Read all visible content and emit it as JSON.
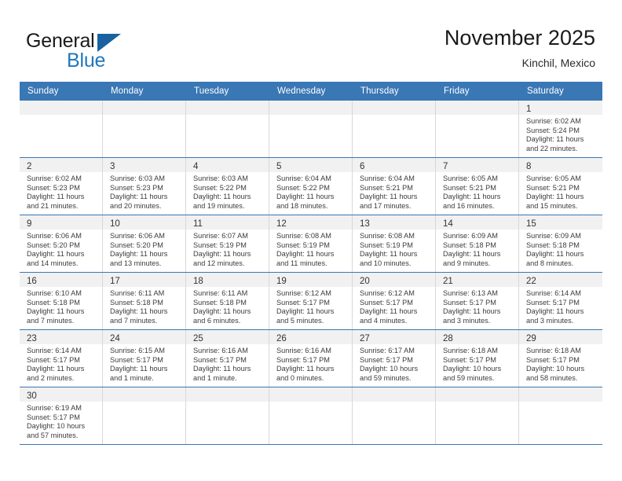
{
  "brand": {
    "name_top": "General",
    "name_bottom": "Blue",
    "accent_color": "#1f77bd",
    "triangle_color": "#18639f"
  },
  "header": {
    "month_title": "November 2025",
    "location": "Kinchil, Mexico",
    "header_band_color": "#3a77b5"
  },
  "weekdays": [
    "Sunday",
    "Monday",
    "Tuesday",
    "Wednesday",
    "Thursday",
    "Friday",
    "Saturday"
  ],
  "weeks": [
    [
      {
        "day": "",
        "sunrise": "",
        "sunset": "",
        "daylight_line1": "",
        "daylight_line2": "",
        "empty": true
      },
      {
        "day": "",
        "sunrise": "",
        "sunset": "",
        "daylight_line1": "",
        "daylight_line2": "",
        "empty": true
      },
      {
        "day": "",
        "sunrise": "",
        "sunset": "",
        "daylight_line1": "",
        "daylight_line2": "",
        "empty": true
      },
      {
        "day": "",
        "sunrise": "",
        "sunset": "",
        "daylight_line1": "",
        "daylight_line2": "",
        "empty": true
      },
      {
        "day": "",
        "sunrise": "",
        "sunset": "",
        "daylight_line1": "",
        "daylight_line2": "",
        "empty": true
      },
      {
        "day": "",
        "sunrise": "",
        "sunset": "",
        "daylight_line1": "",
        "daylight_line2": "",
        "empty": true
      },
      {
        "day": "1",
        "sunrise": "Sunrise: 6:02 AM",
        "sunset": "Sunset: 5:24 PM",
        "daylight_line1": "Daylight: 11 hours",
        "daylight_line2": "and 22 minutes.",
        "empty": false
      }
    ],
    [
      {
        "day": "2",
        "sunrise": "Sunrise: 6:02 AM",
        "sunset": "Sunset: 5:23 PM",
        "daylight_line1": "Daylight: 11 hours",
        "daylight_line2": "and 21 minutes.",
        "empty": false
      },
      {
        "day": "3",
        "sunrise": "Sunrise: 6:03 AM",
        "sunset": "Sunset: 5:23 PM",
        "daylight_line1": "Daylight: 11 hours",
        "daylight_line2": "and 20 minutes.",
        "empty": false
      },
      {
        "day": "4",
        "sunrise": "Sunrise: 6:03 AM",
        "sunset": "Sunset: 5:22 PM",
        "daylight_line1": "Daylight: 11 hours",
        "daylight_line2": "and 19 minutes.",
        "empty": false
      },
      {
        "day": "5",
        "sunrise": "Sunrise: 6:04 AM",
        "sunset": "Sunset: 5:22 PM",
        "daylight_line1": "Daylight: 11 hours",
        "daylight_line2": "and 18 minutes.",
        "empty": false
      },
      {
        "day": "6",
        "sunrise": "Sunrise: 6:04 AM",
        "sunset": "Sunset: 5:21 PM",
        "daylight_line1": "Daylight: 11 hours",
        "daylight_line2": "and 17 minutes.",
        "empty": false
      },
      {
        "day": "7",
        "sunrise": "Sunrise: 6:05 AM",
        "sunset": "Sunset: 5:21 PM",
        "daylight_line1": "Daylight: 11 hours",
        "daylight_line2": "and 16 minutes.",
        "empty": false
      },
      {
        "day": "8",
        "sunrise": "Sunrise: 6:05 AM",
        "sunset": "Sunset: 5:21 PM",
        "daylight_line1": "Daylight: 11 hours",
        "daylight_line2": "and 15 minutes.",
        "empty": false
      }
    ],
    [
      {
        "day": "9",
        "sunrise": "Sunrise: 6:06 AM",
        "sunset": "Sunset: 5:20 PM",
        "daylight_line1": "Daylight: 11 hours",
        "daylight_line2": "and 14 minutes.",
        "empty": false
      },
      {
        "day": "10",
        "sunrise": "Sunrise: 6:06 AM",
        "sunset": "Sunset: 5:20 PM",
        "daylight_line1": "Daylight: 11 hours",
        "daylight_line2": "and 13 minutes.",
        "empty": false
      },
      {
        "day": "11",
        "sunrise": "Sunrise: 6:07 AM",
        "sunset": "Sunset: 5:19 PM",
        "daylight_line1": "Daylight: 11 hours",
        "daylight_line2": "and 12 minutes.",
        "empty": false
      },
      {
        "day": "12",
        "sunrise": "Sunrise: 6:08 AM",
        "sunset": "Sunset: 5:19 PM",
        "daylight_line1": "Daylight: 11 hours",
        "daylight_line2": "and 11 minutes.",
        "empty": false
      },
      {
        "day": "13",
        "sunrise": "Sunrise: 6:08 AM",
        "sunset": "Sunset: 5:19 PM",
        "daylight_line1": "Daylight: 11 hours",
        "daylight_line2": "and 10 minutes.",
        "empty": false
      },
      {
        "day": "14",
        "sunrise": "Sunrise: 6:09 AM",
        "sunset": "Sunset: 5:18 PM",
        "daylight_line1": "Daylight: 11 hours",
        "daylight_line2": "and 9 minutes.",
        "empty": false
      },
      {
        "day": "15",
        "sunrise": "Sunrise: 6:09 AM",
        "sunset": "Sunset: 5:18 PM",
        "daylight_line1": "Daylight: 11 hours",
        "daylight_line2": "and 8 minutes.",
        "empty": false
      }
    ],
    [
      {
        "day": "16",
        "sunrise": "Sunrise: 6:10 AM",
        "sunset": "Sunset: 5:18 PM",
        "daylight_line1": "Daylight: 11 hours",
        "daylight_line2": "and 7 minutes.",
        "empty": false
      },
      {
        "day": "17",
        "sunrise": "Sunrise: 6:11 AM",
        "sunset": "Sunset: 5:18 PM",
        "daylight_line1": "Daylight: 11 hours",
        "daylight_line2": "and 7 minutes.",
        "empty": false
      },
      {
        "day": "18",
        "sunrise": "Sunrise: 6:11 AM",
        "sunset": "Sunset: 5:18 PM",
        "daylight_line1": "Daylight: 11 hours",
        "daylight_line2": "and 6 minutes.",
        "empty": false
      },
      {
        "day": "19",
        "sunrise": "Sunrise: 6:12 AM",
        "sunset": "Sunset: 5:17 PM",
        "daylight_line1": "Daylight: 11 hours",
        "daylight_line2": "and 5 minutes.",
        "empty": false
      },
      {
        "day": "20",
        "sunrise": "Sunrise: 6:12 AM",
        "sunset": "Sunset: 5:17 PM",
        "daylight_line1": "Daylight: 11 hours",
        "daylight_line2": "and 4 minutes.",
        "empty": false
      },
      {
        "day": "21",
        "sunrise": "Sunrise: 6:13 AM",
        "sunset": "Sunset: 5:17 PM",
        "daylight_line1": "Daylight: 11 hours",
        "daylight_line2": "and 3 minutes.",
        "empty": false
      },
      {
        "day": "22",
        "sunrise": "Sunrise: 6:14 AM",
        "sunset": "Sunset: 5:17 PM",
        "daylight_line1": "Daylight: 11 hours",
        "daylight_line2": "and 3 minutes.",
        "empty": false
      }
    ],
    [
      {
        "day": "23",
        "sunrise": "Sunrise: 6:14 AM",
        "sunset": "Sunset: 5:17 PM",
        "daylight_line1": "Daylight: 11 hours",
        "daylight_line2": "and 2 minutes.",
        "empty": false
      },
      {
        "day": "24",
        "sunrise": "Sunrise: 6:15 AM",
        "sunset": "Sunset: 5:17 PM",
        "daylight_line1": "Daylight: 11 hours",
        "daylight_line2": "and 1 minute.",
        "empty": false
      },
      {
        "day": "25",
        "sunrise": "Sunrise: 6:16 AM",
        "sunset": "Sunset: 5:17 PM",
        "daylight_line1": "Daylight: 11 hours",
        "daylight_line2": "and 1 minute.",
        "empty": false
      },
      {
        "day": "26",
        "sunrise": "Sunrise: 6:16 AM",
        "sunset": "Sunset: 5:17 PM",
        "daylight_line1": "Daylight: 11 hours",
        "daylight_line2": "and 0 minutes.",
        "empty": false
      },
      {
        "day": "27",
        "sunrise": "Sunrise: 6:17 AM",
        "sunset": "Sunset: 5:17 PM",
        "daylight_line1": "Daylight: 10 hours",
        "daylight_line2": "and 59 minutes.",
        "empty": false
      },
      {
        "day": "28",
        "sunrise": "Sunrise: 6:18 AM",
        "sunset": "Sunset: 5:17 PM",
        "daylight_line1": "Daylight: 10 hours",
        "daylight_line2": "and 59 minutes.",
        "empty": false
      },
      {
        "day": "29",
        "sunrise": "Sunrise: 6:18 AM",
        "sunset": "Sunset: 5:17 PM",
        "daylight_line1": "Daylight: 10 hours",
        "daylight_line2": "and 58 minutes.",
        "empty": false
      }
    ],
    [
      {
        "day": "30",
        "sunrise": "Sunrise: 6:19 AM",
        "sunset": "Sunset: 5:17 PM",
        "daylight_line1": "Daylight: 10 hours",
        "daylight_line2": "and 57 minutes.",
        "empty": false
      },
      {
        "day": "",
        "sunrise": "",
        "sunset": "",
        "daylight_line1": "",
        "daylight_line2": "",
        "empty": true
      },
      {
        "day": "",
        "sunrise": "",
        "sunset": "",
        "daylight_line1": "",
        "daylight_line2": "",
        "empty": true
      },
      {
        "day": "",
        "sunrise": "",
        "sunset": "",
        "daylight_line1": "",
        "daylight_line2": "",
        "empty": true
      },
      {
        "day": "",
        "sunrise": "",
        "sunset": "",
        "daylight_line1": "",
        "daylight_line2": "",
        "empty": true
      },
      {
        "day": "",
        "sunrise": "",
        "sunset": "",
        "daylight_line1": "",
        "daylight_line2": "",
        "empty": true
      },
      {
        "day": "",
        "sunrise": "",
        "sunset": "",
        "daylight_line1": "",
        "daylight_line2": "",
        "empty": true
      }
    ]
  ]
}
